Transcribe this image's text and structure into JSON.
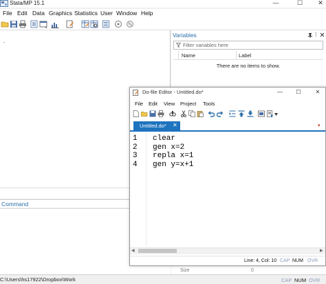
{
  "app": {
    "title": "Stata/MP 15.1"
  },
  "window_controls": {
    "minimize": "—",
    "maximize": "☐",
    "close": "✕"
  },
  "menubar": [
    "File",
    "Edit",
    "Data",
    "Graphics",
    "Statistics",
    "User",
    "Window",
    "Help"
  ],
  "toolbar": {
    "icons": [
      "open-icon",
      "save-icon",
      "print-icon",
      "log-icon",
      "viewer-icon",
      "graph-icon",
      "dofile-editor-icon",
      "data-editor-icon",
      "data-browser-icon",
      "variables-manager-icon",
      "more-icon",
      "break-icon"
    ]
  },
  "results": {
    "prompt": "."
  },
  "command": {
    "title": "Command"
  },
  "variables": {
    "title": "Variables",
    "filter_placeholder": "Filter variables here",
    "columns": [
      "Name",
      "Label"
    ],
    "empty_message": "There are no items to show.",
    "size_label": "Size",
    "size_value": "0"
  },
  "statusbar": {
    "path": "C:\\Users\\hs17922\\Dropbox\\Work",
    "flags": [
      "CAP",
      "NUM",
      "OVR"
    ]
  },
  "dofile": {
    "title": "Do-file Editor - Untitled.do*",
    "menu": [
      "File",
      "Edit",
      "View",
      "Project",
      "Tools"
    ],
    "tab_label": "Untitled.do*",
    "tab_close": "✕",
    "tab_menu": "▾",
    "lines": [
      {
        "num": "1",
        "code": "clear"
      },
      {
        "num": "2",
        "code": "gen x=2"
      },
      {
        "num": "3",
        "code": "repla x=1"
      },
      {
        "num": "4",
        "code": "gen y=x+1"
      }
    ],
    "status": {
      "position": "Line: 4, Col: 10",
      "flags": [
        "CAP",
        "NUM",
        "OVR"
      ]
    }
  },
  "colors": {
    "accent": "#1e73be",
    "pane_title": "#2a6ea8"
  }
}
